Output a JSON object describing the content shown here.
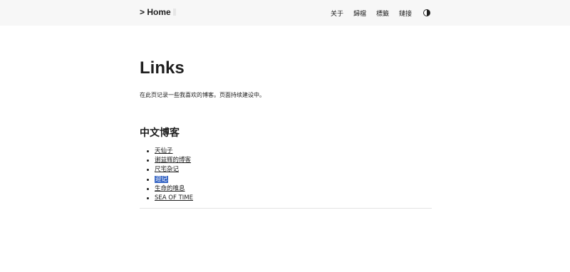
{
  "header": {
    "logo": "> Home",
    "nav": [
      {
        "label": "关于"
      },
      {
        "label": "歸檔"
      },
      {
        "label": "標籤"
      },
      {
        "label": "鏈接"
      }
    ],
    "theme_toggle_icon": "contrast-icon"
  },
  "main": {
    "title": "Links",
    "intro": "在此页记录一些我喜欢的博客。页面持续建设中。",
    "section": {
      "heading": "中文博客",
      "links": [
        {
          "label": "天仙子"
        },
        {
          "label": "谢益辉的博客"
        },
        {
          "label": "尺宅杂记"
        },
        {
          "label": "迎记",
          "selected": true
        },
        {
          "label": "生命的唯息"
        },
        {
          "label": "SEA OF TIME"
        }
      ]
    }
  },
  "colors": {
    "header_bg": "#f7f7f7",
    "text": "#1e1e1e",
    "selection": "#3766c5",
    "divider": "#e3e3e3"
  }
}
